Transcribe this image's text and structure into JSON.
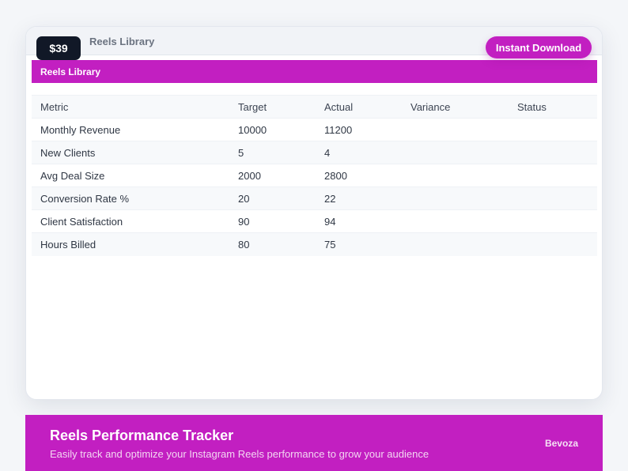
{
  "price": "$39",
  "header": {
    "title": "Reels Library"
  },
  "actions": {
    "download_label": "Instant Download"
  },
  "sheet": {
    "title": "Reels Library"
  },
  "table": {
    "columns": [
      "Metric",
      "Target",
      "Actual",
      "Variance",
      "Status"
    ],
    "rows": [
      [
        "Monthly Revenue",
        "10000",
        "11200",
        "",
        ""
      ],
      [
        "New Clients",
        "5",
        "4",
        "",
        ""
      ],
      [
        "Avg Deal Size",
        "2000",
        "2800",
        "",
        ""
      ],
      [
        "Conversion Rate %",
        "20",
        "22",
        "",
        ""
      ],
      [
        "Client Satisfaction",
        "90",
        "94",
        "",
        ""
      ],
      [
        "Hours Billed",
        "80",
        "75",
        "",
        ""
      ]
    ]
  },
  "footer": {
    "title": "Reels Performance Tracker",
    "subtitle": "Easily track and optimize your Instagram Reels performance to grow your audience",
    "brand": "Bevoza"
  },
  "colors": {
    "accent": "#c21fc1",
    "badge": "#111827",
    "background": "#f4f6f9"
  }
}
